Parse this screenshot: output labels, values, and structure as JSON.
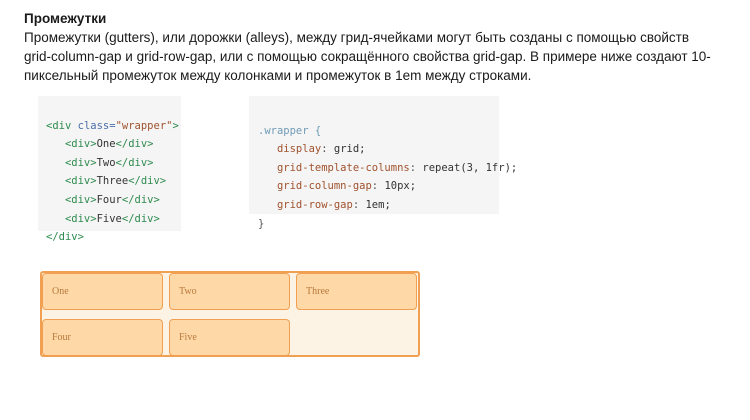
{
  "heading": "Промежутки",
  "paragraph": "Промежутки (gutters), или дорожки (alleys), между грид-ячейками могут быть созданы с помощью свойств grid-column-gap и grid-row-gap, или с помощью сокращённого свойства grid-gap. В примере ниже  создают 10-пиксельный промежуток между колонками и промежуток в 1em между строками.",
  "html_code": {
    "open_tag": "<div",
    "attr_name": " class=",
    "attr_value": "\"wrapper\"",
    "open_close": ">",
    "items": [
      "One",
      "Two",
      "Three",
      "Four",
      "Five"
    ],
    "close_tag": "</div>"
  },
  "css_code": {
    "selector": ".wrapper {",
    "rules": [
      {
        "prop": "display",
        "value": " grid;"
      },
      {
        "prop": "grid-template-columns",
        "value": " repeat(3, 1fr);"
      },
      {
        "prop": "grid-column-gap",
        "value": " 10px;"
      },
      {
        "prop": "grid-row-gap",
        "value": " 1em;"
      }
    ],
    "close": "}"
  },
  "grid_items": [
    "One",
    "Two",
    "Three",
    "Four",
    "Five"
  ],
  "colors": {
    "cell_bg": "#ffd8a8",
    "cell_border": "#f0a050",
    "wrapper_bg": "#fdf3e4"
  }
}
